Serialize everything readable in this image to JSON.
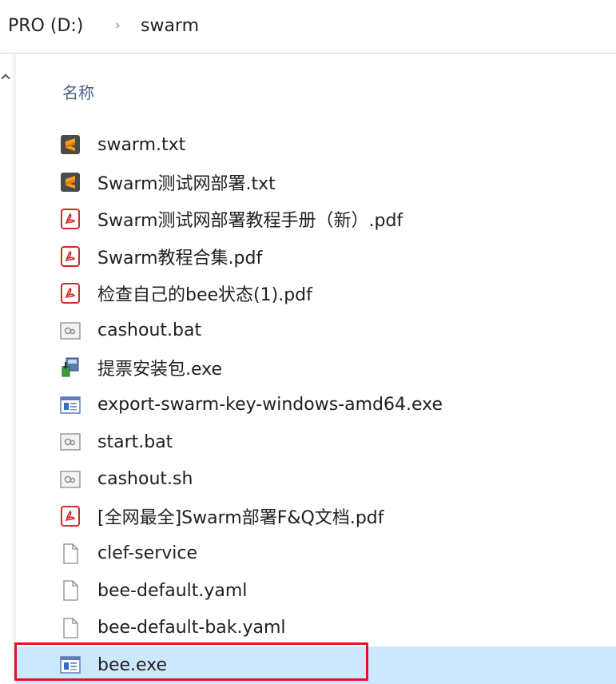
{
  "breadcrumb": {
    "root": "PRO (D:)",
    "separator": "›",
    "folder": "swarm"
  },
  "columns": {
    "name_header": "名称"
  },
  "files": [
    {
      "name": "swarm.txt",
      "icon": "sublime-text-icon"
    },
    {
      "name": "Swarm测试网部署.txt",
      "icon": "sublime-text-icon"
    },
    {
      "name": "Swarm测试网部署教程手册（新）.pdf",
      "icon": "pdf-icon"
    },
    {
      "name": "Swarm教程合集.pdf",
      "icon": "pdf-icon"
    },
    {
      "name": "检查自己的bee状态(1).pdf",
      "icon": "pdf-icon"
    },
    {
      "name": "cashout.bat",
      "icon": "batch-file-icon"
    },
    {
      "name": "提票安装包.exe",
      "icon": "installer-icon"
    },
    {
      "name": "export-swarm-key-windows-amd64.exe",
      "icon": "application-icon"
    },
    {
      "name": "start.bat",
      "icon": "batch-file-icon"
    },
    {
      "name": "cashout.sh",
      "icon": "batch-file-icon"
    },
    {
      "name": "[全网最全]Swarm部署F&Q文档.pdf",
      "icon": "pdf-icon"
    },
    {
      "name": "clef-service",
      "icon": "blank-file-icon"
    },
    {
      "name": "bee-default.yaml",
      "icon": "blank-file-icon"
    },
    {
      "name": "bee-default-bak.yaml",
      "icon": "blank-file-icon"
    },
    {
      "name": "bee.exe",
      "icon": "application-icon",
      "selected": true
    }
  ],
  "colors": {
    "selection": "#cce8ff",
    "highlight_border": "#e0141e",
    "header_text": "#4d6082"
  }
}
